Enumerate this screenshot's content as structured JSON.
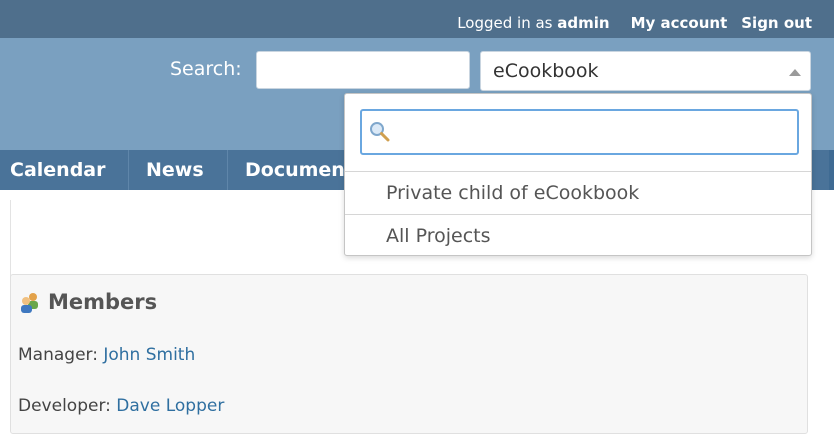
{
  "top_menu": {
    "logged_in_prefix": "Logged in as",
    "username": "admin",
    "my_account": "My account",
    "sign_out": "Sign out"
  },
  "search": {
    "label": "Search:",
    "value": "",
    "placeholder": ""
  },
  "project_selector": {
    "selected": "eCookbook",
    "filter_value": "",
    "options": [
      "Private child of eCookbook",
      "All Projects"
    ]
  },
  "tabs": [
    "Calendar",
    "News",
    "Documents"
  ],
  "members": {
    "title": "Members",
    "rows": [
      {
        "role": "Manager:",
        "name": "John Smith"
      },
      {
        "role": "Developer:",
        "name": "Dave Lopper"
      }
    ]
  },
  "colors": {
    "topbar": "#4f6f8c",
    "header": "#7aa0c0",
    "tabs": "#4a7399",
    "link": "#2f6fa0",
    "focus": "#6aa7e0"
  },
  "icons": [
    "members-icon",
    "search-magnifier-icon",
    "select-caret-icon"
  ]
}
